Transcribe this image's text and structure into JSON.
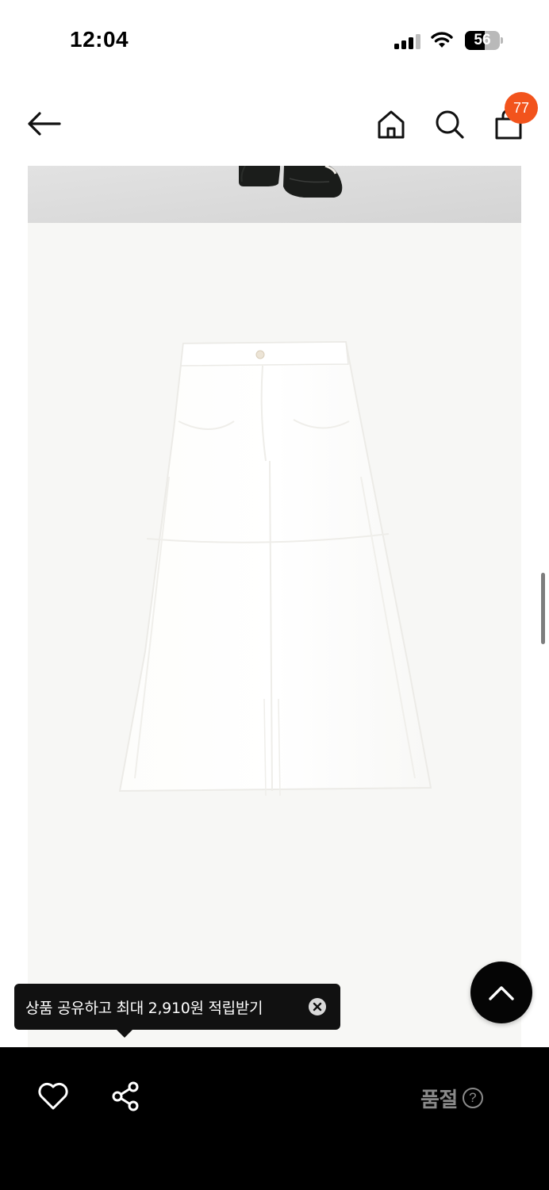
{
  "status_bar": {
    "time": "12:04",
    "battery_level": "56",
    "battery_fraction": 0.56,
    "icons": [
      "signal-icon",
      "wifi-icon",
      "battery-icon"
    ]
  },
  "nav": {
    "icons": [
      "back-arrow-icon",
      "home-icon",
      "search-icon",
      "shopping-bag-icon"
    ],
    "cart_badge": "77",
    "badge_color": "#f2531c"
  },
  "product": {
    "main_image": "white long denim skirt with front slit",
    "top_photo": "model wearing black loafers"
  },
  "tooltip": {
    "text": "상품 공유하고 최대 2,910원 적립받기"
  },
  "bottom_bar": {
    "soldout_label": "품절",
    "help_icon_glyph": "?",
    "icons": [
      "heart-icon",
      "share-icon",
      "help-icon"
    ]
  },
  "colors": {
    "background": "#ffffff",
    "bottom_bar": "#000000",
    "product_bg": "#f7f7f5",
    "soldout_text": "#8a8a8a"
  }
}
